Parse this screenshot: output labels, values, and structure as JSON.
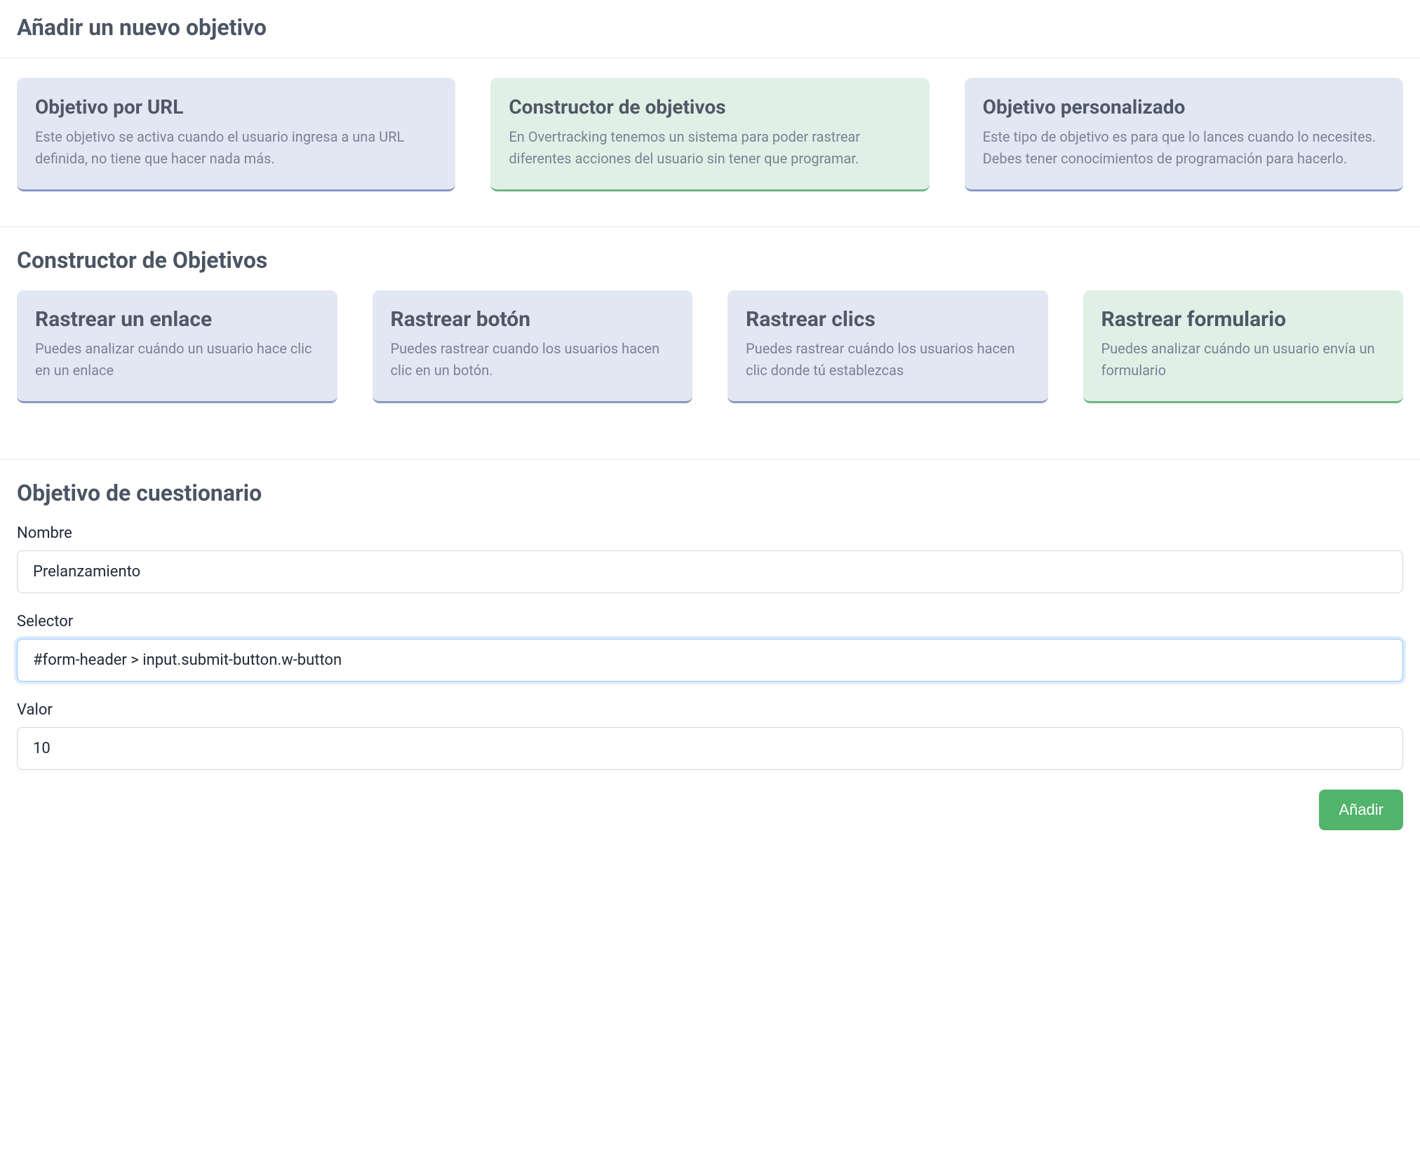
{
  "header": {
    "title": "Añadir un nuevo objetivo"
  },
  "objective_types": [
    {
      "title": "Objetivo por URL",
      "description": "Este objetivo se activa cuando el usuario ingresa a una URL definida, no tiene que hacer nada más."
    },
    {
      "title": "Constructor de objetivos",
      "description": "En Overtracking tenemos un sistema para poder rastrear diferentes acciones del usuario sin tener que programar."
    },
    {
      "title": "Objetivo personalizado",
      "description": "Este tipo de objetivo es para que lo lances cuando lo necesites. Debes tener conocimientos de programación para hacerlo."
    }
  ],
  "constructor": {
    "title": "Constructor de Objetivos",
    "options": [
      {
        "title": "Rastrear un enlace",
        "description": "Puedes analizar cuándo un usuario hace clic en un enlace"
      },
      {
        "title": "Rastrear botón",
        "description": "Puedes rastrear cuando los usuarios hacen clic en un botón."
      },
      {
        "title": "Rastrear clics",
        "description": "Puedes rastrear cuándo los usuarios hacen clic donde tú establezcas"
      },
      {
        "title": "Rastrear formulario",
        "description": "Puedes analizar cuándo un usuario envía un formulario"
      }
    ]
  },
  "form": {
    "title": "Objetivo de cuestionario",
    "fields": {
      "name": {
        "label": "Nombre",
        "value": "Prelanzamiento"
      },
      "selector": {
        "label": "Selector",
        "value": "#form-header > input.submit-button.w-button"
      },
      "value": {
        "label": "Valor",
        "value": "10"
      }
    },
    "submit_label": "Añadir"
  }
}
